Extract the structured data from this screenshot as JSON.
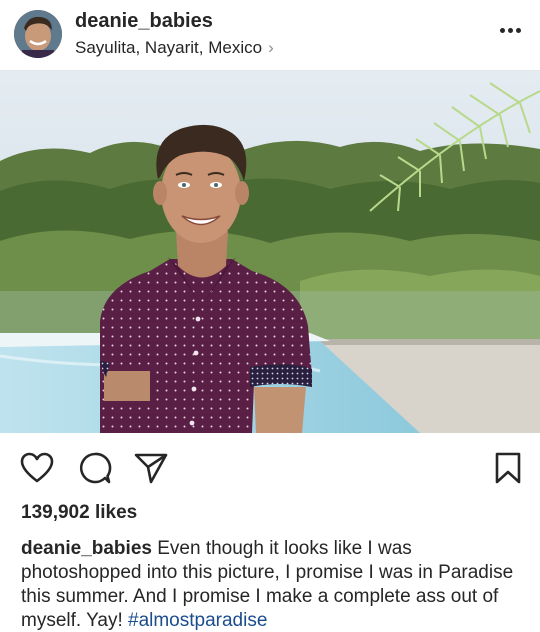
{
  "post": {
    "username": "deanie_babies",
    "location": "Sayulita, Nayarit, Mexico",
    "location_chevron": "›",
    "more_icon": "more-horizontal-icon"
  },
  "actions": {
    "like_icon": "heart-icon",
    "comment_icon": "comment-icon",
    "share_icon": "send-icon",
    "save_icon": "bookmark-icon"
  },
  "likes": "139,902 likes",
  "caption": {
    "username": "deanie_babies",
    "text": " Even though it looks like I was photoshopped into this picture, I promise I was in Paradise this summer. And I promise I make a complete ass out of myself. Yay! ",
    "hashtag": "#almostparadise"
  },
  "colors": {
    "text": "#262626",
    "hashtag": "#1b4d8e",
    "divider": "#e6e6e6"
  }
}
